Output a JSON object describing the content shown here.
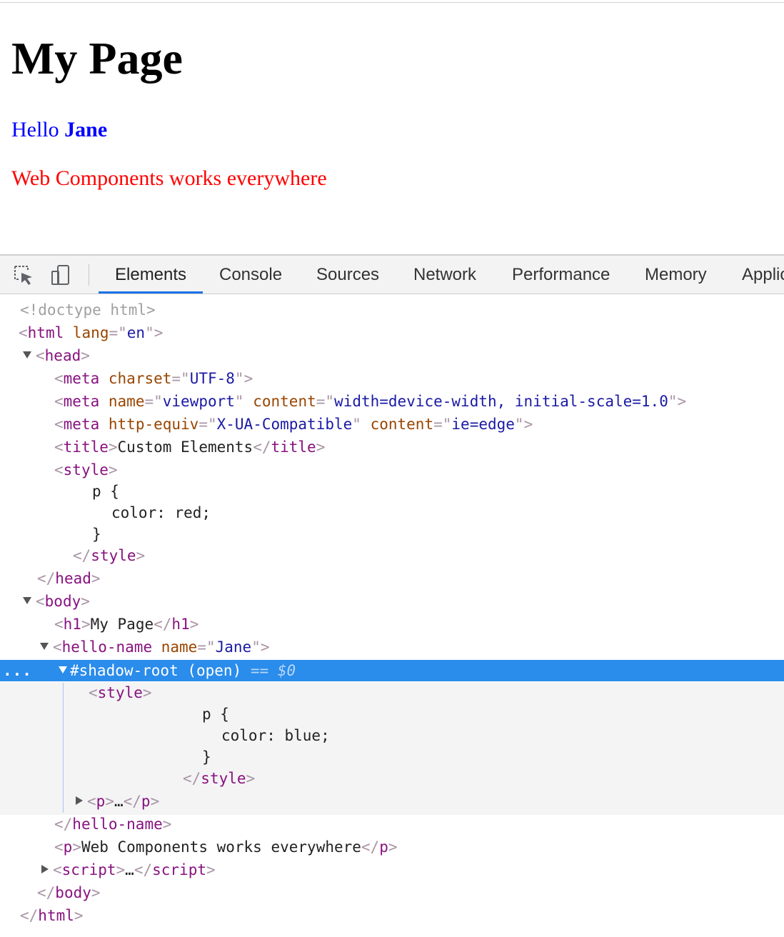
{
  "page": {
    "heading": "My Page",
    "hello_prefix": "Hello ",
    "hello_name": "Jane",
    "paragraph": "Web Components works everywhere"
  },
  "devtools": {
    "icons": [
      "inspect-element-icon",
      "device-toolbar-icon"
    ],
    "tabs": [
      "Elements",
      "Console",
      "Sources",
      "Network",
      "Performance",
      "Memory",
      "Applic"
    ],
    "active_tab": "Elements",
    "accent_color": "#1a73e8",
    "selection_color": "#2a8ceb",
    "tree": {
      "doctype": "<!doctype html>",
      "html_tag": "html",
      "html_attr": "lang",
      "html_val": "en",
      "head_tag": "head",
      "meta_tag": "meta",
      "charset_attr": "charset",
      "charset_val": "UTF-8",
      "name_attr": "name",
      "viewport_val": "viewport",
      "content_attr": "content",
      "viewport_content": "width=device-width, initial-scale=1.0",
      "httpequiv_attr": "http-equiv",
      "httpequiv_val": "X-UA-Compatible",
      "ie_content": "ie=edge",
      "title_tag": "title",
      "title_text": "Custom Elements",
      "style_tag": "style",
      "css_p_open": "p {",
      "css_red": "color: red;",
      "css_close": "}",
      "body_tag": "body",
      "h1_tag": "h1",
      "h1_text": "My Page",
      "hello_tag": "hello-name",
      "hello_attr": "name",
      "hello_val": "Jane",
      "shadow_root": "#shadow-root (open)",
      "shadow_eq": "==",
      "shadow_ref": "$0",
      "css_blue": "color: blue;",
      "p_tag": "p",
      "ellipsis": "…",
      "p_text": "Web Components works everywhere",
      "script_tag": "script",
      "row_dots": "..."
    }
  }
}
